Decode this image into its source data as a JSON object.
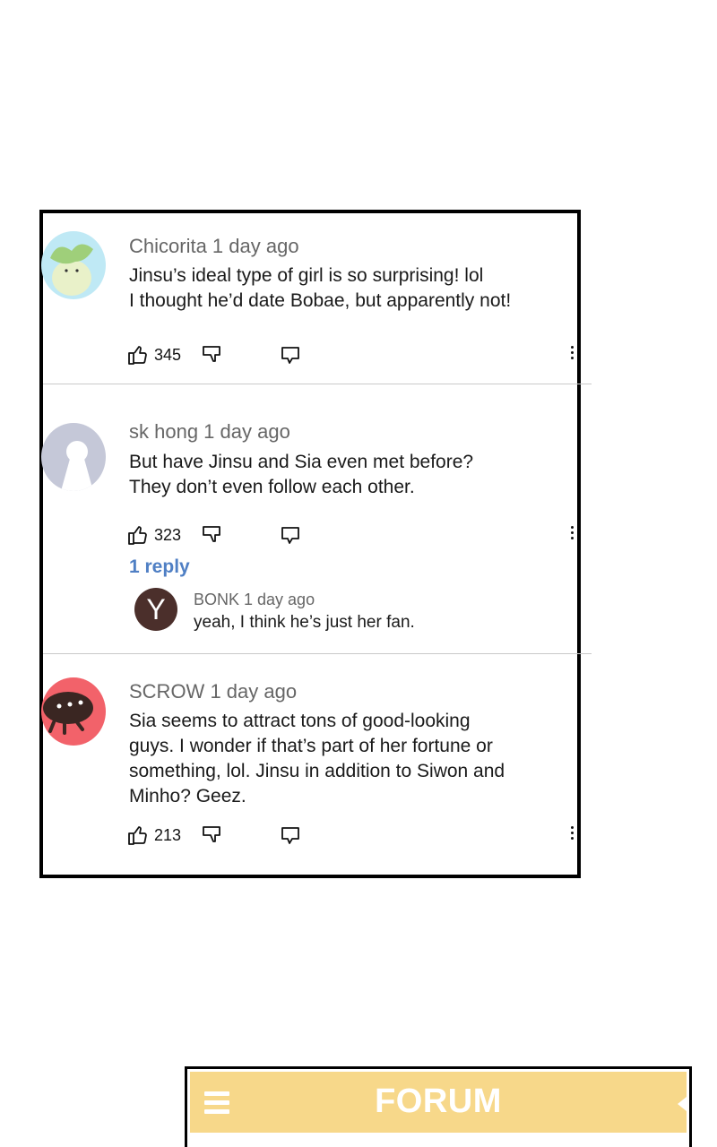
{
  "comments": [
    {
      "author": "Chicorita 1 day ago",
      "lines": [
        "Jinsu’s ideal type of girl is so surprising! lol",
        "I thought he’d date Bobae, but apparently not!"
      ],
      "likes": "345",
      "avatar_color": "#bfe9f5"
    },
    {
      "author": "sk hong 1 day ago",
      "lines": [
        "But have Jinsu and Sia even met before?",
        "They don’t even follow each other."
      ],
      "likes": "323",
      "avatar_color": "#c5c8d8",
      "reply_link": "1 reply",
      "reply": {
        "avatar_letter": "Y",
        "author": "BONK 1 day ago",
        "text": "yeah, I think he’s just her fan."
      }
    },
    {
      "author": "SCROW 1 day ago",
      "lines": [
        "Sia seems to attract tons of good-looking",
        "guys. I wonder if that’s part of her fortune or",
        "something, lol. Jinsu in addition to Siwon and",
        "Minho? Geez."
      ],
      "likes": "213",
      "avatar_color": "#f2626a"
    }
  ],
  "forum": {
    "title": "FORUM",
    "bar_color": "#f7d88a"
  }
}
